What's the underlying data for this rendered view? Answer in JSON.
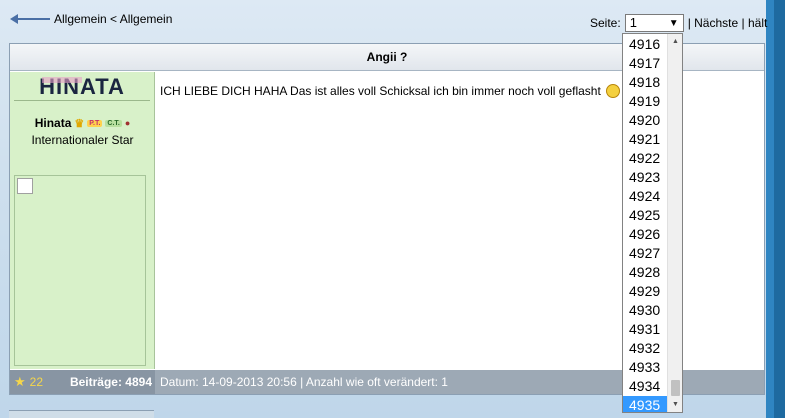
{
  "nav": {
    "back_text": "Allgemein < Allgemein",
    "page_label": "Seite:",
    "page_value": "1",
    "next_link": "Nächste",
    "halt_link": "hält"
  },
  "post": {
    "title": "Angii ?",
    "message": "ICH LIEBE DICH HAHA Das ist alles voll Schicksal ich bin immer noch voll geflasht",
    "footer_date": "Datum: 14-09-2013 20:56 | Anzahl wie oft verändert: 1"
  },
  "user": {
    "banner_text": "HINATA",
    "name": "Hinata",
    "badge_1": "P.T.",
    "badge_2": "C.T.",
    "rank": "Internationaler Star",
    "stars": "22",
    "posts_label": "Beiträge: 4894"
  },
  "dropdown": {
    "options": [
      "4916",
      "4917",
      "4918",
      "4919",
      "4920",
      "4921",
      "4922",
      "4923",
      "4924",
      "4925",
      "4926",
      "4927",
      "4928",
      "4929",
      "4930",
      "4931",
      "4932",
      "4933",
      "4934",
      "4935"
    ],
    "selected": "4935"
  },
  "colors": {
    "user_panel": "#d8f1c9",
    "footer": "#9da9b5",
    "selected": "#3399ff"
  },
  "icons": [
    "arrow-left-icon",
    "crown-icon",
    "smiley-icon",
    "star-icon",
    "dropdown-arrow-icon",
    "scroll-up-icon",
    "scroll-down-icon"
  ]
}
